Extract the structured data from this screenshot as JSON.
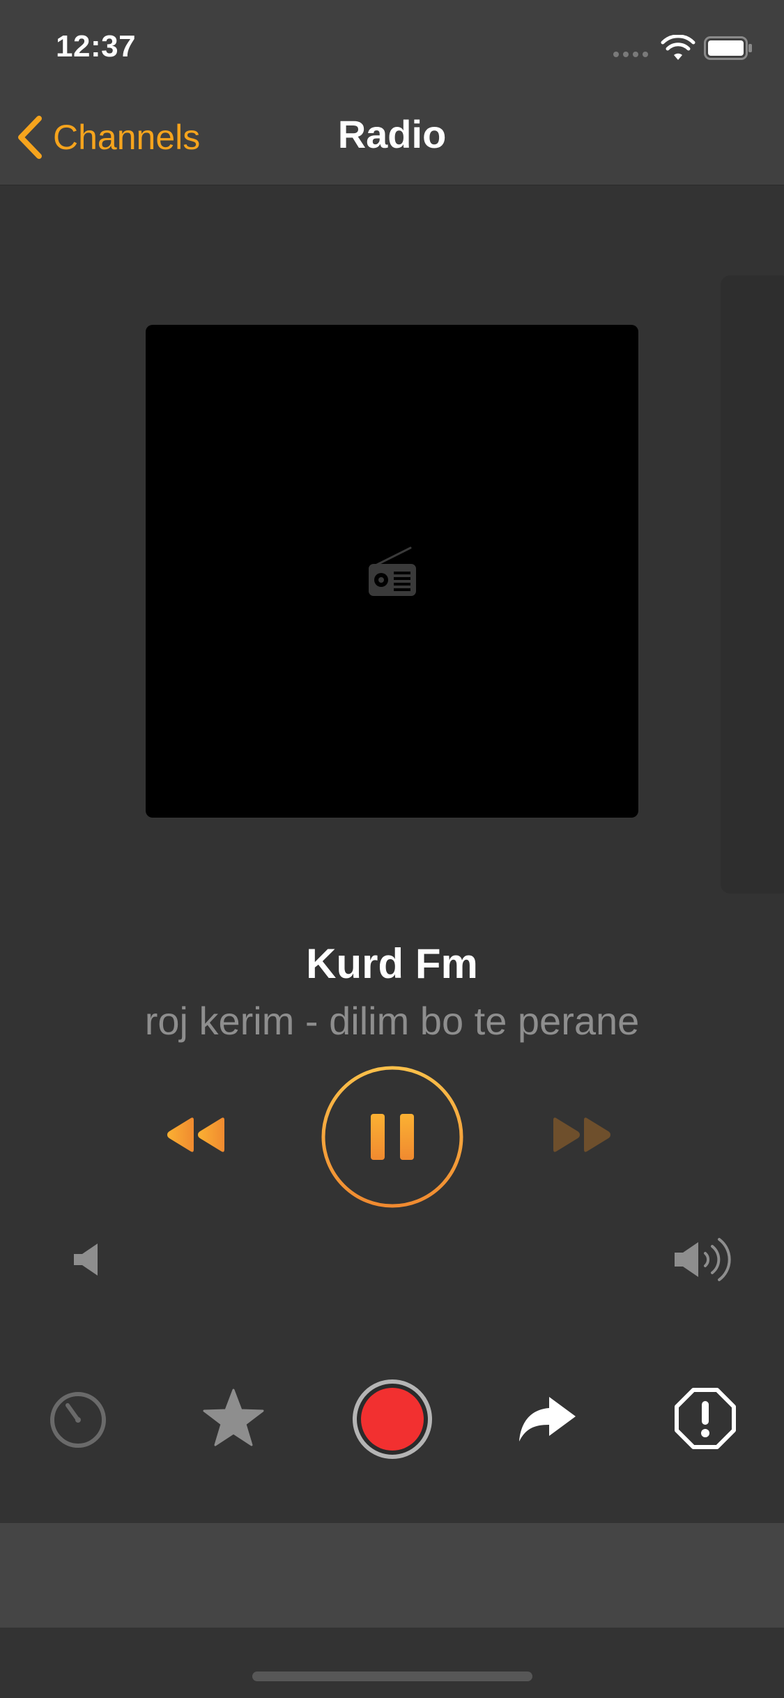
{
  "status_bar": {
    "time": "12:37"
  },
  "nav": {
    "back_label": "Channels",
    "title": "Radio"
  },
  "player": {
    "station_name": "Kurd Fm",
    "track_title": "roj kerim - dilim bo te perane",
    "state": "playing"
  },
  "icons": {
    "back": "chevron-left-icon",
    "artwork": "radio-icon",
    "prev": "rewind-icon",
    "play_pause": "pause-icon",
    "next": "fast-forward-icon",
    "volume_min": "speaker-low-icon",
    "volume_max": "speaker-high-icon",
    "timer": "sleep-timer-icon",
    "favorite": "star-icon",
    "record": "record-icon",
    "share": "share-icon",
    "report": "report-icon"
  },
  "colors": {
    "accent": "#f6a41d",
    "accent_orange": "#f08a30",
    "record_red": "#f23030",
    "background": "#333333",
    "bar": "#404040"
  }
}
